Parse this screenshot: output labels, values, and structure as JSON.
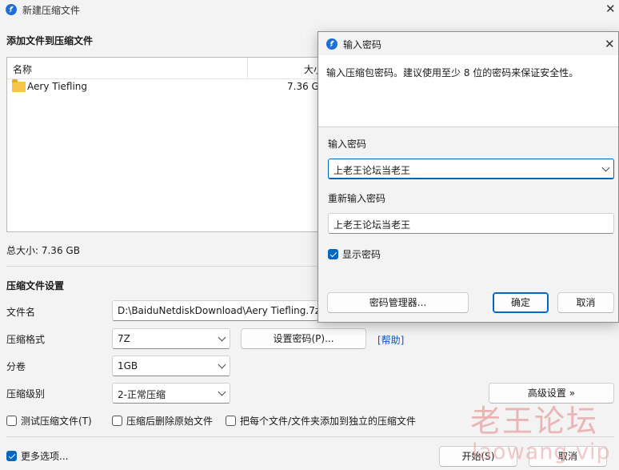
{
  "main": {
    "title": "新建压缩文件",
    "close_glyph": "✕",
    "add_section_title": "添加文件到压缩文件",
    "columns": {
      "name": "名称",
      "size": "大小"
    },
    "files": [
      {
        "name": "Aery Tiefling",
        "size": "7.36 GB",
        "icon": "folder-icon"
      }
    ],
    "total_size": "总大小: 7.36 GB",
    "settings_title": "压缩文件设置",
    "filename_label": "文件名",
    "filename_value": "D:\\BaiduNetdiskDownload\\Aery Tiefling.7z",
    "format_label": "压缩格式",
    "format_value": "7Z",
    "set_password_button": "设置密码(P)...",
    "help_link": "[帮助]",
    "split_label": "分卷",
    "split_value": "1GB",
    "level_label": "压缩级别",
    "level_value": "2-正常压缩",
    "advanced_button": "高级设置 »",
    "test_checkbox": "测试压缩文件(T)",
    "delete_checkbox": "压缩后删除原始文件",
    "separate_checkbox": "把每个文件/文件夹添加到独立的压缩文件",
    "more_options": "更多选项...",
    "start_button": "开始(S)",
    "cancel_button": "取消"
  },
  "dialog": {
    "title": "输入密码",
    "close_glyph": "✕",
    "description": "输入压缩包密码。建议使用至少 8 位的密码来保证安全性。",
    "password_label": "输入密码",
    "password_value": "上老王论坛当老王",
    "confirm_label": "重新输入密码",
    "confirm_value": "上老王论坛当老王",
    "show_password": "显示密码",
    "manager_button": "密码管理器...",
    "ok_button": "确定",
    "cancel_button": "取消"
  },
  "watermark": {
    "line1": "老王论坛",
    "line2": "laowang.vip"
  },
  "colors": {
    "accent": "#0067c0",
    "link": "#0a54c7",
    "watermark": "#e9a6a6"
  }
}
